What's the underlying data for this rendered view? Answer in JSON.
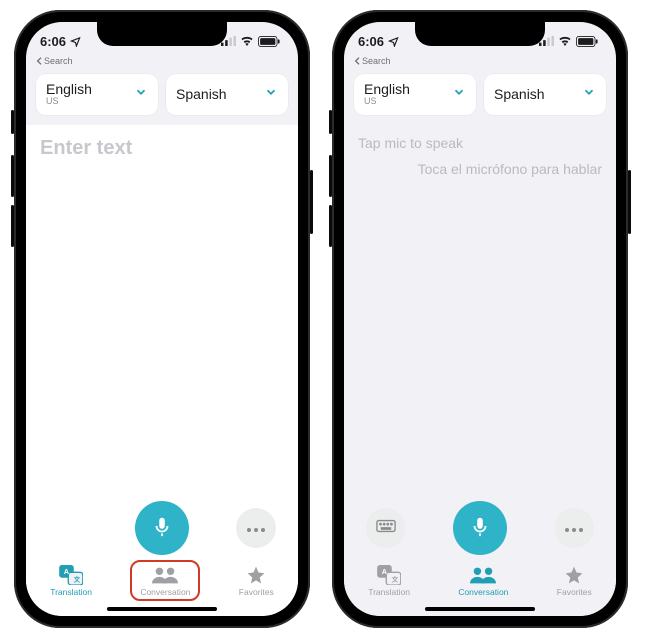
{
  "status": {
    "time": "6:06",
    "breadcrumb": "Search"
  },
  "languages": {
    "source": {
      "name": "English",
      "region": "US"
    },
    "target": {
      "name": "Spanish",
      "region": ""
    }
  },
  "left": {
    "placeholder": "Enter text"
  },
  "right": {
    "prompt_source": "Tap mic to speak",
    "prompt_target": "Toca el micrófono para hablar"
  },
  "tabs": {
    "translation": "Translation",
    "conversation": "Conversation",
    "favorites": "Favorites"
  },
  "colors": {
    "accent": "#2fb3c9",
    "highlight": "#d13a27"
  }
}
